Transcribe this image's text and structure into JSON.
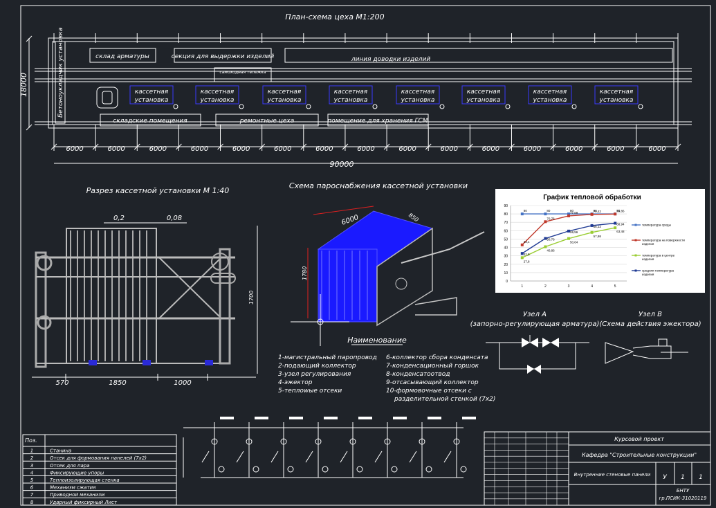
{
  "plan": {
    "title": "План-схема  цеха М1:200",
    "height_dim": "18000",
    "total_dim": "90000",
    "bay_dims": [
      "6000",
      "6000",
      "6000",
      "6000",
      "6000",
      "6000",
      "6000",
      "6000",
      "6000",
      "6000",
      "6000",
      "6000",
      "6000",
      "6000",
      "6000"
    ],
    "zones": {
      "warehouse_rebar": "склад арматуры",
      "curing_section": "секция для выдержки изделий",
      "finishing_line": "линия доводки изделий",
      "trolley": "самоходная тележка",
      "storage_rooms": "складские помещения",
      "repair_shops": "ремонтные цеха",
      "fuel_storage": "помещение для хранения ГСМ",
      "concrete_unit": "Бетоноукладчик установка"
    },
    "cassette_label_1": "кассетная",
    "cassette_label_2": "установка"
  },
  "section": {
    "title": "Разрез кассетной установки М 1:40",
    "dim_top_1": "0,2",
    "dim_top_2": "0,08",
    "dim_bottom": [
      "570",
      "1850",
      "1000"
    ],
    "dim_height": "1700"
  },
  "steam": {
    "title": "Схема пароснабжения кассетной установки",
    "dim_length": "6000",
    "dim_height": "1780",
    "dim_width": "850"
  },
  "legend": {
    "title": "Наименование",
    "left": [
      "1-магистральный паропровод",
      "2-подающий коллектор",
      "3-узел регулирования",
      "4-эжектор",
      "5-теплowые отсеки"
    ],
    "right": [
      "6-коллектор сбора конденсата",
      "7-конденсационный горшок",
      "8-конденсатоотвод",
      "9-отсасывающий коллектор",
      "10-формовочные отсеки с",
      "разделительной стенкой (7х2)"
    ]
  },
  "node_a": {
    "title": "Узел А",
    "subtitle": "(запорно-регулирующая арматура)"
  },
  "node_b": {
    "title": "Узел В",
    "subtitle": "(Схема действия эжектора)"
  },
  "spec_table": {
    "header": "Поз.",
    "rows": [
      {
        "pos": "1",
        "name": "Станина"
      },
      {
        "pos": "2",
        "name": "Отсек для формования панелей (7х2)"
      },
      {
        "pos": "3",
        "name": "Отсек для пара"
      },
      {
        "pos": "4",
        "name": "Фиксирующие упоры"
      },
      {
        "pos": "5",
        "name": "Теплоизолирующая стенка"
      },
      {
        "pos": "6",
        "name": "Механизм сжатия"
      },
      {
        "pos": "7",
        "name": "Приводной механизм"
      },
      {
        "pos": "8",
        "name": "Ударный фиксирный Лист"
      }
    ]
  },
  "title_block": {
    "project": "Курсовой проект",
    "department": "Кафедра \"Строительные конструкции\"",
    "drawing": "Внутренние стеновые панели",
    "stage": "У",
    "sheet": "1",
    "sheets": "1",
    "org": "БНТУ",
    "group": "гр.ПСИК-31020119"
  },
  "colors": {
    "background": "#1f2329",
    "line": "#ffffff",
    "blue": "#1a1aff",
    "series_air": "#4472c4",
    "series_surface": "#c0392b",
    "series_center": "#9acd32",
    "series_avg": "#1f3a93"
  },
  "chart_data": {
    "type": "line",
    "title": "График тепловой обработки",
    "x": [
      1,
      2,
      3,
      4,
      5
    ],
    "ylim": [
      0,
      90
    ],
    "yticks": [
      0,
      10,
      20,
      30,
      40,
      50,
      60,
      70,
      80,
      90
    ],
    "grid": true,
    "legend_position": "right",
    "series": [
      {
        "name": "температура среды",
        "values": [
          80,
          80,
          80,
          80,
          80
        ],
        "labels": [
          "80",
          "80",
          "80",
          "80",
          "80"
        ]
      },
      {
        "name": "температура на поверхности изделия",
        "values": [
          43.1,
          70.76,
          77.69,
          79.42,
          79.86
        ],
        "labels": [
          "43,1",
          "70,76",
          "77,69",
          "79,42",
          "79,86"
        ]
      },
      {
        "name": "температура в центре изделия",
        "values": [
          27.8,
          40.86,
          50.64,
          57.98,
          63.48
        ],
        "labels": [
          "27,8",
          "40,86",
          "50,64",
          "57,98",
          "63,48"
        ]
      },
      {
        "name": "средняя температура изделия",
        "values": [
          32.9,
          50.76,
          59.56,
          66.12,
          68.94
        ],
        "labels": [
          "32,9",
          "50,76",
          "59,56",
          "66,12",
          "68,94"
        ]
      }
    ]
  }
}
